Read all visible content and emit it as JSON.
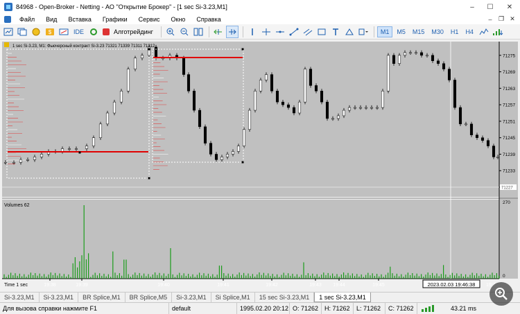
{
  "window": {
    "title": "84968 - Open-Broker - Netting - АО ''Открытие Брокер'' - [1 sec Si-3.23,M1]",
    "controls": [
      "–",
      "☐",
      "✕"
    ]
  },
  "menu": [
    "Файл",
    "Вид",
    "Вставка",
    "Графики",
    "Сервис",
    "Окно",
    "Справка"
  ],
  "toolbar": {
    "ide_label": "IDE",
    "algo_label": "Алготрейдинг",
    "timeframes": [
      "M1",
      "M5",
      "M15",
      "M30",
      "H1",
      "H4"
    ],
    "active_timeframe": "M1"
  },
  "chart": {
    "header": "1 sec Si-3.23, M1:  Фьючерсный контракт Si-3.23   71321 71339 71311 71312",
    "volumes_label": "Volumes 62",
    "time_label": "Time 1 sec",
    "price_ticks": [
      "71275",
      "71269",
      "71263",
      "71257",
      "71251",
      "71245",
      "71239",
      "71233",
      "71227"
    ],
    "current_price": "71227",
    "volume_ticks": [
      "270",
      "0"
    ],
    "time_ticks": [
      "19:38",
      "19:39",
      "19:40",
      "19:41",
      "19:42",
      "19:43",
      "19:44",
      "19:45"
    ],
    "crosshair_time": "2023.02.03 19:46:38",
    "crosshair_price": "19:4",
    "colors": {
      "background": "#c0c0c0",
      "candle": "#000000",
      "volume": "#1a9c1a",
      "level_line": "#e00000"
    }
  },
  "tabs": [
    "Si-3.23,M1",
    "Si-3.23,M1",
    "BR Splice,M1",
    "BR Splice,M5",
    "Si-3.23,M1",
    "Si Splice,M1",
    "15 sec Si-3.23,M1",
    "1 sec Si-3.23,M1"
  ],
  "active_tab_index": 7,
  "status": {
    "help": "Для вызова справки нажмите F1",
    "profile": "default",
    "datetime": "1995.02.20 20:12",
    "open": "O: 71262",
    "high": "H: 71262",
    "low": "L: 71262",
    "close": "C: 71262",
    "traffic": "43.21 ms"
  }
}
